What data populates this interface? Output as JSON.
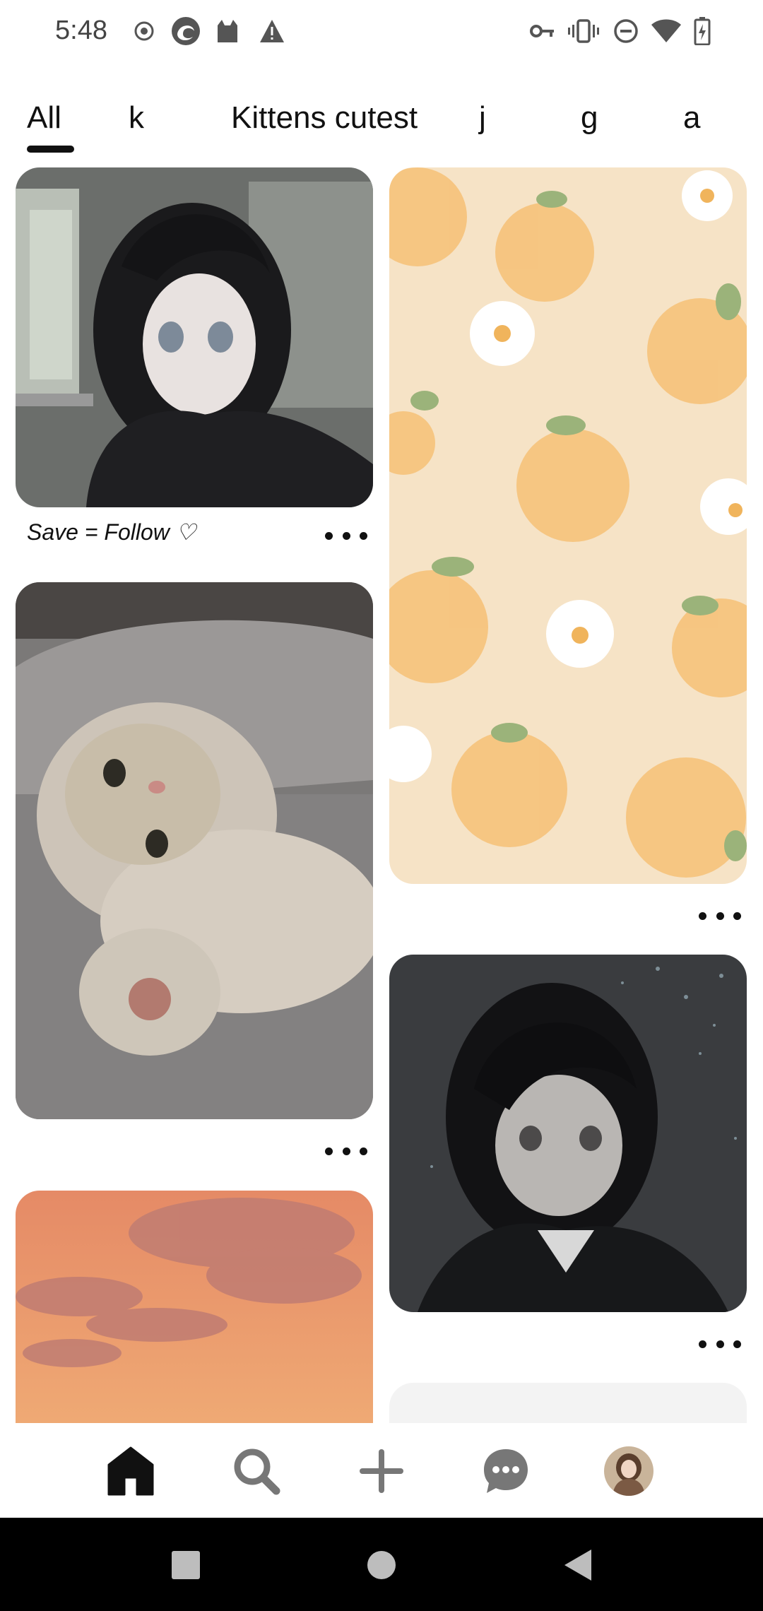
{
  "status_bar": {
    "time": "5:48",
    "left_icons": [
      "record-icon",
      "browser-icon",
      "cat-app-icon",
      "warning-icon"
    ],
    "right_icons": [
      "vpn-key-icon",
      "vibrate-icon",
      "do-not-disturb-icon",
      "wifi-icon",
      "battery-charging-icon"
    ]
  },
  "tabs": [
    {
      "label": "All",
      "active": true
    },
    {
      "label": "k",
      "active": false
    },
    {
      "label": "Kittens cutest",
      "active": false
    },
    {
      "label": "j",
      "active": false
    },
    {
      "label": "g",
      "active": false
    },
    {
      "label": "a",
      "active": false
    }
  ],
  "feed": {
    "pins": [
      {
        "image": "anime girl dark hair by window",
        "caption": "Save = Follow ♡"
      },
      {
        "image": "orange and flower pattern wallpaper",
        "caption": ""
      },
      {
        "image": "kitten lying on couch",
        "caption": ""
      },
      {
        "image": "anime girl dark background",
        "caption": ""
      },
      {
        "image": "sunset clouds",
        "caption": ""
      },
      {
        "image": "loading placeholder",
        "caption": ""
      }
    ]
  },
  "bottom_nav": {
    "items": [
      "home-icon",
      "search-icon",
      "create-plus-icon",
      "messages-icon",
      "profile-avatar"
    ],
    "active": "home-icon"
  },
  "system_nav": [
    "recents-square-icon",
    "home-circle-icon",
    "back-triangle-icon"
  ]
}
